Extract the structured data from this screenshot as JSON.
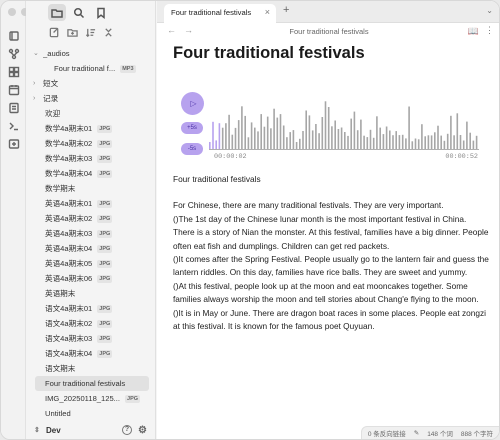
{
  "sidebar": {
    "vault_name": "Dev",
    "items": [
      {
        "label": "_audios",
        "kind": "folder",
        "open": true
      },
      {
        "label": "Four traditional f...",
        "kind": "sub",
        "badge": "MP3"
      },
      {
        "label": "短文",
        "kind": "folder",
        "open": false
      },
      {
        "label": "记录",
        "kind": "folder",
        "open": false
      },
      {
        "label": "欢迎",
        "kind": "file"
      },
      {
        "label": "数学4a期末01",
        "kind": "file",
        "badge": "JPG"
      },
      {
        "label": "数学4a期末02",
        "kind": "file",
        "badge": "JPG"
      },
      {
        "label": "数学4a期末03",
        "kind": "file",
        "badge": "JPG"
      },
      {
        "label": "数学4a期末04",
        "kind": "file",
        "badge": "JPG"
      },
      {
        "label": "数学期末",
        "kind": "file"
      },
      {
        "label": "英语4a期末01",
        "kind": "file",
        "badge": "JPG"
      },
      {
        "label": "英语4a期末02",
        "kind": "file",
        "badge": "JPG"
      },
      {
        "label": "英语4a期末03",
        "kind": "file",
        "badge": "JPG"
      },
      {
        "label": "英语4a期末04",
        "kind": "file",
        "badge": "JPG"
      },
      {
        "label": "英语4a期末05",
        "kind": "file",
        "badge": "JPG"
      },
      {
        "label": "英语4a期末06",
        "kind": "file",
        "badge": "JPG"
      },
      {
        "label": "英语期末",
        "kind": "file"
      },
      {
        "label": "语文4a期末01",
        "kind": "file",
        "badge": "JPG"
      },
      {
        "label": "语文4a期末02",
        "kind": "file",
        "badge": "JPG"
      },
      {
        "label": "语文4a期末03",
        "kind": "file",
        "badge": "JPG"
      },
      {
        "label": "语文4a期末04",
        "kind": "file",
        "badge": "JPG"
      },
      {
        "label": "语文期末",
        "kind": "file"
      },
      {
        "label": "Four traditional festivals",
        "kind": "file",
        "selected": true
      },
      {
        "label": "IMG_20250118_125...",
        "kind": "file",
        "badge": "JPG"
      },
      {
        "label": "Untitled",
        "kind": "file"
      }
    ]
  },
  "tab": {
    "title": "Four traditional festivals"
  },
  "navbar": {
    "title": "Four traditional festivals"
  },
  "note": {
    "title": "Four traditional festivals",
    "audio": {
      "current_time": "00:00:02",
      "total_time": "00:00:52",
      "skip_forward": "+5s",
      "skip_back": "-5s",
      "progress": 0.04,
      "accent": "#b7a2ee"
    },
    "heading_line": "Four traditional festivals",
    "paragraphs": [
      "For Chinese, there are many traditional festivals. They are very important.",
      "()The 1st day of the Chinese lunar month is the most important festival in China. There is a story of Nian the monster. At this festival, families have a big dinner. People often eat fish and dumplings. Children can get red packets.",
      "()It comes after the Spring Festival. People usually go to the lantern fair and guess the lantern riddles. On this day, families have rice balls. They are sweet and yummy.",
      "()At this festival, people look up at the moon and eat mooncakes together. Some families always worship the moon and tell stories about Chang'e flying to the moon.",
      "()It is in May or June. There are dragon boat races in some places. People eat zongzi at this festival. It is known for the famous poet Quyuan."
    ]
  },
  "status": {
    "backlinks": "0 条反向链接",
    "words": "148 个词",
    "chars": "888 个字符"
  }
}
